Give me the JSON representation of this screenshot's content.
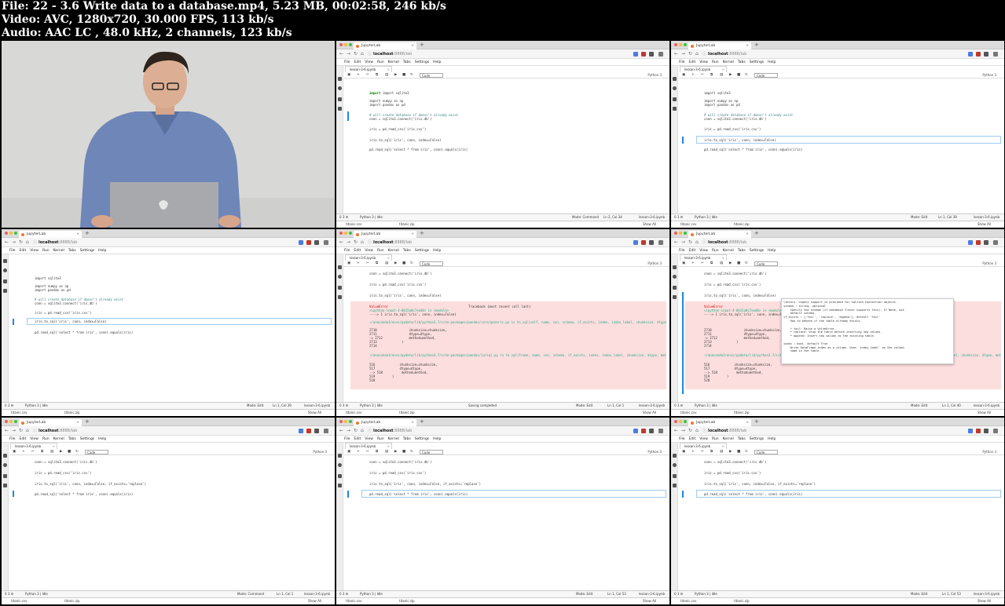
{
  "header": {
    "file": "File: 22 - 3.6 Write data to a database.mp4, 5.23 MB, 00:02:58, 246 kb/s",
    "video": "Video: AVC, 1280x720, 30.000 FPS, 113 kb/s",
    "audio": "Audio: AAC LC , 48.0 kHz, 2 channels, 123 kb/s"
  },
  "browser": {
    "tab_title": "JupyterLab",
    "url_host": "localhost",
    "url_path": ":8888/lab",
    "menus": [
      "File",
      "Edit",
      "View",
      "Run",
      "Kernel",
      "Tabs",
      "Settings",
      "Help"
    ],
    "notebook_tab": "lesson-3-6.ipynb",
    "cell_type": "Code",
    "kernel": "Python 3",
    "downloads": [
      "titanic.csv",
      "titanic.zip"
    ],
    "show_all": "Show All"
  },
  "code": {
    "import_sqlite": "import sqlite3",
    "import_numpy": "import numpy as np",
    "import_pandas": "import pandas as pd",
    "comment": "# will create database if doesn't already exist",
    "connect": "conn = sqlite3.connect('iris.db')",
    "read_csv": "iris = pd.read_csv('iris.csv')",
    "to_sql": "iris.to_sql('iris', conn, index=False)",
    "to_sql_replace": "iris.to_sql('iris', conn, index=False, if_exists='replace')",
    "read_sql": "pd.read_sql('select * from iris', conn).equals(iris)"
  },
  "error": {
    "name": "ValueError",
    "traceback_label": "Traceback (most recent call last)",
    "input_ref": "<ipython-input-4-0b15a0c7eed8> in <module>",
    "arrow_line": "----> 1 iris.to_sql('iris', conn, index=False)",
    "generic_path": "~/anaconda3/envs/pydata/lib/python3.7/site-packages/pandas/core/generic.py in to_sql(self, name, con, schema, if_exists, index, index_label, chunksize, dtype, method)",
    "l2710": "2710                 chunksize=chunksize,",
    "l2711": "2711                 dtype=dtype,",
    "l2712": "-> 2712              method=method,",
    "l2713": "2713             )",
    "l2714": "2714",
    "sql_path": "~/anaconda3/envs/pydata/lib/python3.7/site-packages/pandas/io/sql.py in to_sql(frame, name, con, schema, if_exists, index, index_label, chunksize, dtype, method)",
    "l516": "516             chunksize=chunksize,",
    "l517": "517             dtype=dtype,",
    "l518": "--> 518          method=method,",
    "l519": "519         )",
    "l520": "520"
  },
  "tooltip": {
    "lines": [
      "library. Legacy support is provided for sqlite3.Connection objects.",
      "schema : string, optional",
      "    Specify the schema (if database flavor supports this). If None, use",
      "    default schema.",
      "if_exists : {'fail', 'replace', 'append'}, default 'fail'",
      "    How to behave if the table already exists.",
      "",
      "    * fail: Raise a ValueError.",
      "    * replace: Drop the table before inserting new values.",
      "    * append: Insert new values to the existing table.",
      "",
      "index : bool, default True",
      "    Write DataFrame index as a column. Uses `index_label` as the column",
      "    name in the table."
    ]
  },
  "status": {
    "counts": "0  3  ⚙",
    "kernel_idle": "Python 3 | Idle",
    "mode_command": "Mode: Command",
    "mode_edit": "Mode: Edit",
    "saving": "Saving completed",
    "frames": [
      {
        "pos": "Ln 2, Col 34",
        "mode": "Mode: Command"
      },
      {
        "pos": "Ln 1, Col 39",
        "mode": "Mode: Edit"
      },
      {
        "pos": "Ln 1, Col 39",
        "mode": "Mode: Edit"
      },
      {
        "pos": "Ln 1, Col 1",
        "mode": "Mode: Edit"
      },
      {
        "pos": "Ln 1, Col 40",
        "mode": "Mode: Edit"
      },
      {
        "pos": "Ln 1, Col 1",
        "mode": "Mode: Command"
      },
      {
        "pos": "Ln 1, Col 53",
        "mode": "Mode: Edit"
      },
      {
        "pos": "Ln 1, Col 53",
        "mode": "Mode: Edit"
      }
    ],
    "notebook": "lesson-3-6.ipynb"
  },
  "colors": {
    "error_bg": "#fddede",
    "active_bar": "#1e88e5",
    "keyword": "#008000",
    "string": "#ba2121"
  }
}
